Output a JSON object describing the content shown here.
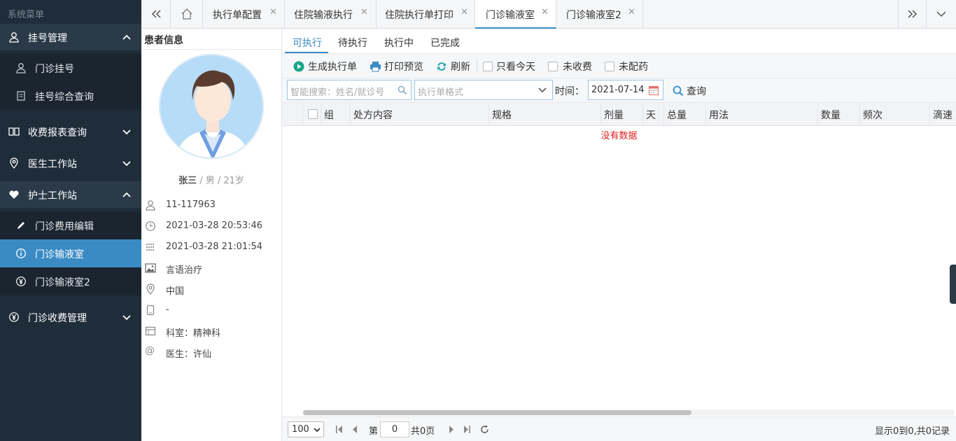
{
  "sidebar": {
    "title": "系统菜单",
    "groups": [
      {
        "label": "挂号管理",
        "icon": "user-icon",
        "items": [
          {
            "label": "门诊挂号",
            "icon": "user-icon"
          },
          {
            "label": "挂号综合查询",
            "icon": "document-icon"
          }
        ]
      },
      {
        "label": "收费报表查询",
        "icon": "book-icon"
      },
      {
        "label": "医生工作站",
        "icon": "location-icon"
      },
      {
        "label": "护士工作站",
        "icon": "heart-icon",
        "items": [
          {
            "label": "门诊费用编辑",
            "icon": "pencil-icon"
          },
          {
            "label": "门诊输液室",
            "icon": "info-icon",
            "active": true
          },
          {
            "label": "门诊输液室2",
            "icon": "yen-icon"
          }
        ]
      },
      {
        "label": "门诊收费管理",
        "icon": "yen-icon"
      }
    ]
  },
  "tabs": [
    {
      "label": "执行单配置"
    },
    {
      "label": "住院输液执行"
    },
    {
      "label": "住院执行单打印"
    },
    {
      "label": "门诊输液室",
      "active": true
    },
    {
      "label": "门诊输液室2"
    }
  ],
  "patient": {
    "header": "患者信息",
    "name": "张三",
    "gender_age": " / 男 / 21岁",
    "info": [
      {
        "icon": "user-icon",
        "value": "11-117963"
      },
      {
        "icon": "clock-icon",
        "value": "2021-03-28 20:53:46"
      },
      {
        "icon": "calendar-grid-icon",
        "value": "2021-03-28 21:01:54"
      },
      {
        "icon": "image-icon",
        "value": "言语治疗"
      },
      {
        "icon": "location-icon",
        "value": "中国"
      },
      {
        "icon": "phone-icon",
        "value": "-"
      },
      {
        "icon": "calendar-icon",
        "value": "科室：精神科"
      },
      {
        "icon": "at-icon",
        "value": "医生：许仙"
      }
    ]
  },
  "main": {
    "subtabs": [
      "可执行",
      "待执行",
      "执行中",
      "已完成"
    ],
    "toolbar": {
      "generate": "生成执行单",
      "print_preview": "打印预览",
      "refresh": "刷新",
      "today_only": "只看今天",
      "unpaid": "未收费",
      "undispensed": "未配药"
    },
    "filter": {
      "search_placeholder": "智能搜索：姓名/就诊号",
      "format_placeholder": "执行单格式",
      "time_label": "时间：",
      "date_value": "2021-07-14",
      "query": "查询"
    },
    "columns": [
      "组",
      "处方内容",
      "规格",
      "剂量",
      "天",
      "总量",
      "用法",
      "数量",
      "频次",
      "滴速"
    ],
    "no_data": "没有数据",
    "pager": {
      "page_size": "100",
      "page_label": "第",
      "page_value": "0",
      "total_pages": "共0页",
      "summary": "显示0到0,共0记录"
    }
  },
  "colors": {
    "accent": "#3a8bc4",
    "sidebar_bg": "#1f2d3a",
    "no_data": "#e02020"
  }
}
